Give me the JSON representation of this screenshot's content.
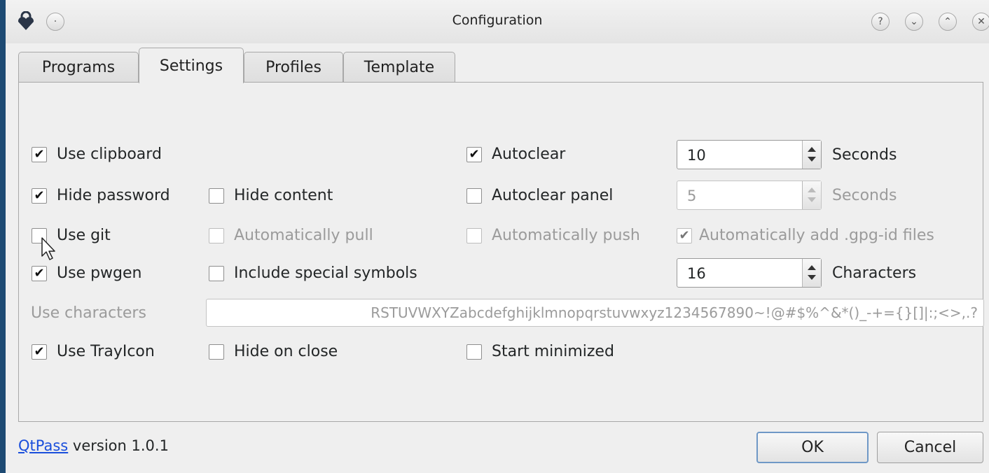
{
  "window": {
    "title": "Configuration"
  },
  "tabs": [
    {
      "label": "Programs",
      "active": false
    },
    {
      "label": "Settings",
      "active": true
    },
    {
      "label": "Profiles",
      "active": false
    },
    {
      "label": "Template",
      "active": false
    }
  ],
  "settings": {
    "use_clipboard": {
      "label": "Use clipboard",
      "checked": true
    },
    "autoclear": {
      "label": "Autoclear",
      "checked": true,
      "value": "10",
      "unit": "Seconds"
    },
    "hide_password": {
      "label": "Hide password",
      "checked": true
    },
    "hide_content": {
      "label": "Hide content",
      "checked": false
    },
    "autoclear_panel": {
      "label": "Autoclear panel",
      "checked": false,
      "value": "5",
      "unit": "Seconds"
    },
    "use_git": {
      "label": "Use git",
      "checked": false
    },
    "auto_pull": {
      "label": "Automatically pull",
      "checked": false
    },
    "auto_push": {
      "label": "Automatically push",
      "checked": false
    },
    "auto_add_gpg": {
      "label": "Automatically add .gpg-id files",
      "checked": true
    },
    "use_pwgen": {
      "label": "Use pwgen",
      "checked": true
    },
    "special_symbols": {
      "label": "Include special symbols",
      "checked": false
    },
    "length": {
      "value": "16",
      "unit": "Characters"
    },
    "use_characters": {
      "label": "Use characters",
      "value": "RSTUVWXYZabcdefghijklmnopqrstuvwxyz1234567890~!@#$%^&*()_-+={}[]|:;<>,.?"
    },
    "use_trayicon": {
      "label": "Use TrayIcon",
      "checked": true
    },
    "hide_on_close": {
      "label": "Hide on close",
      "checked": false
    },
    "start_minimized": {
      "label": "Start minimized",
      "checked": false
    }
  },
  "footer": {
    "link": "QtPass",
    "version": " version 1.0.1",
    "ok": "OK",
    "cancel": "Cancel"
  },
  "check_glyph": "✔"
}
